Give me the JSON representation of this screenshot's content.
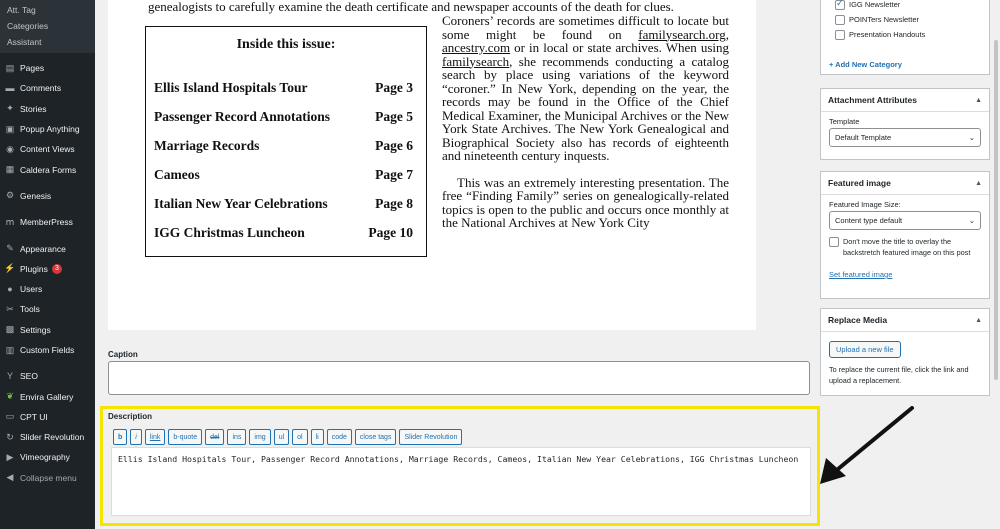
{
  "sidebar": {
    "submenu": [
      "Att. Tag",
      "Categories",
      "Assistant"
    ],
    "items": [
      {
        "label": "Pages",
        "icon": "pages-icon"
      },
      {
        "label": "Comments",
        "icon": "comments-icon"
      },
      {
        "label": "Stories",
        "icon": "stories-icon"
      },
      {
        "label": "Popup Anything",
        "icon": "popup-icon"
      },
      {
        "label": "Content Views",
        "icon": "content-views-icon"
      },
      {
        "label": "Caldera Forms",
        "icon": "caldera-icon"
      },
      {
        "label": "Genesis",
        "icon": "genesis-icon"
      },
      {
        "label": "MemberPress",
        "icon": "memberpress-icon"
      },
      {
        "label": "Appearance",
        "icon": "appearance-icon"
      },
      {
        "label": "Plugins",
        "icon": "plugins-icon",
        "badge": "3"
      },
      {
        "label": "Users",
        "icon": "users-icon"
      },
      {
        "label": "Tools",
        "icon": "tools-icon"
      },
      {
        "label": "Settings",
        "icon": "settings-icon"
      },
      {
        "label": "Custom Fields",
        "icon": "custom-fields-icon"
      },
      {
        "label": "SEO",
        "icon": "seo-icon"
      },
      {
        "label": "Envira Gallery",
        "icon": "envira-icon"
      },
      {
        "label": "CPT UI",
        "icon": "cpt-icon"
      },
      {
        "label": "Slider Revolution",
        "icon": "slider-icon"
      },
      {
        "label": "Vimeography",
        "icon": "vimeo-icon"
      },
      {
        "label": "Collapse menu",
        "icon": "collapse-icon"
      }
    ]
  },
  "document": {
    "top_line": "genealogists to carefully examine the death certificate and newspaper accounts of the death for clues.",
    "para1": {
      "a": "Coroners’ records are sometimes difficult to locate but some might be found on ",
      "link1": "familysearch.org,",
      "b": " ",
      "link2": "ancestry.com",
      "c": " or in local or state archives. When using ",
      "link3": "familysearch",
      "d": ", she recommends conducting a catalog search by place using variations of the keyword “coroner.” In New York, depending on the year, the records may be found in the Office of the Chief Medical Examiner, the Municipal Archives or the New York State Archives. The New York Genealogical and Biographical Society also has records of eighteenth and nineteenth century inquests."
    },
    "para2": "This was an extremely interesting presentation. The free “Finding Family” series on genealogically-related topics is open to the public and occurs once monthly at the National Archives at New York City",
    "inside": {
      "title": "Inside this issue:",
      "rows": [
        {
          "item": "Ellis Island Hospitals Tour",
          "page": "Page 3"
        },
        {
          "item": "Passenger Record Annotations",
          "page": "Page 5"
        },
        {
          "item": "Marriage Records",
          "page": "Page 6"
        },
        {
          "item": "Cameos",
          "page": "Page 7"
        },
        {
          "item": "Italian New Year Celebrations",
          "page": "Page 8"
        },
        {
          "item": "IGG Christmas Luncheon",
          "page": "Page 10"
        }
      ]
    }
  },
  "caption": {
    "label": "Caption",
    "value": ""
  },
  "description": {
    "label": "Description",
    "toolbar": [
      "b",
      "i",
      "link",
      "b-quote",
      "del",
      "ins",
      "img",
      "ul",
      "ol",
      "li",
      "code",
      "close tags",
      "Slider Revolution"
    ],
    "value": "Ellis Island Hospitals Tour, Passenger Record Annotations, Marriage Records, Cameos, Italian New Year Celebrations, IGG Christmas Luncheon"
  },
  "categories": {
    "items": [
      {
        "label": "IGG Newsletter",
        "checked": true
      },
      {
        "label": "POINTers Newsletter",
        "checked": false
      },
      {
        "label": "Presentation Handouts",
        "checked": false
      }
    ],
    "add_link": "+ Add New Category"
  },
  "attachment": {
    "title": "Attachment Attributes",
    "template_label": "Template",
    "template_value": "Default Template"
  },
  "featured": {
    "title": "Featured image",
    "size_label": "Featured Image Size:",
    "size_value": "Content type default",
    "checkbox_label": "Don't move the title to overlay the backstretch featured image on this post",
    "set_link": "Set featured image"
  },
  "replace": {
    "title": "Replace Media",
    "button": "Upload a new file",
    "help": "To replace the current file, click the link and upload a replacement."
  },
  "colors": {
    "sidebar": "#1d2327",
    "accent": "#2271b1",
    "highlight": "#f5e400",
    "badge": "#d63638"
  }
}
